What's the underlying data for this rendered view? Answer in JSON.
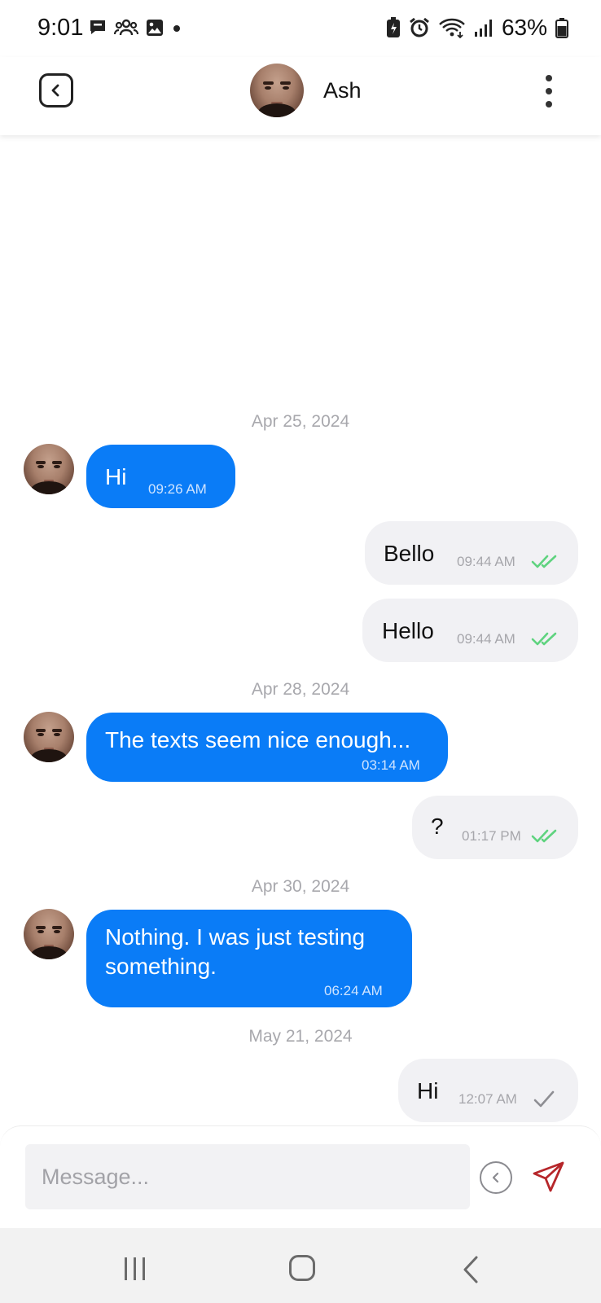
{
  "status_bar": {
    "time": "9:01",
    "battery": "63%",
    "left_icons": [
      "chat-icon",
      "group-icon",
      "image-icon",
      "dot-icon"
    ],
    "right_icons": [
      "battery-saver-icon",
      "alarm-icon",
      "wifi-icon",
      "signal-icon",
      "battery-icon"
    ]
  },
  "header": {
    "contact_name": "Ash"
  },
  "chat": {
    "dates": [
      "Apr 25, 2024",
      "Apr 28, 2024",
      "Apr 30, 2024",
      "May 21, 2024"
    ],
    "messages": [
      {
        "direction": "incoming",
        "text": "Hi",
        "time": "09:26 AM"
      },
      {
        "direction": "outgoing",
        "text": "Bello",
        "time": "09:44 AM",
        "status": "read"
      },
      {
        "direction": "outgoing",
        "text": "Hello",
        "time": "09:44 AM",
        "status": "read"
      },
      {
        "direction": "incoming",
        "text": "The texts seem nice enough...",
        "time": "03:14 AM"
      },
      {
        "direction": "outgoing",
        "text": "?",
        "time": "01:17 PM",
        "status": "read"
      },
      {
        "direction": "incoming",
        "text": "Nothing. I was just testing",
        "text_line2": "something.",
        "time": "06:24 AM"
      },
      {
        "direction": "outgoing",
        "text": "Hi",
        "time": "12:07 AM",
        "status": "sent"
      }
    ]
  },
  "composer": {
    "placeholder": "Message..."
  },
  "colors": {
    "incoming_bubble": "#0a7cf7",
    "outgoing_bubble": "#f1f1f4",
    "read_check": "#5fd37f",
    "sent_check": "#8e8e93",
    "send_icon": "#b6262a"
  }
}
